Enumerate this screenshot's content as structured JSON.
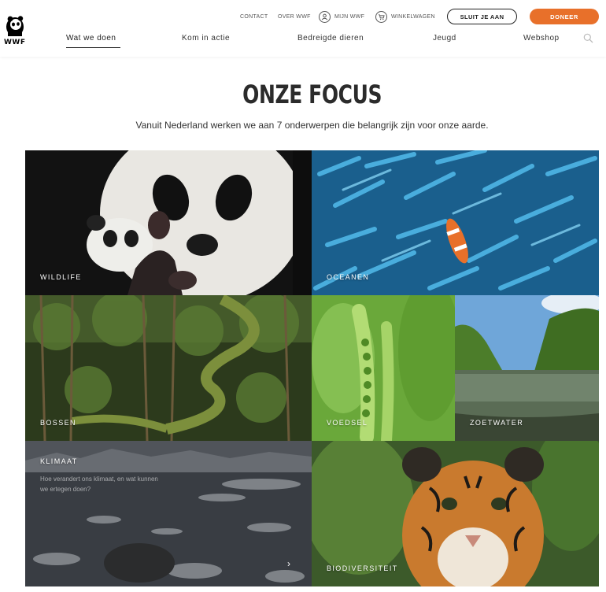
{
  "brand": {
    "logo_text": "WWF",
    "accent_color": "#e8702a"
  },
  "utility_nav": {
    "contact": "CONTACT",
    "over_wwf": "OVER WWF",
    "mijn_wwf": "MIJN WWF",
    "winkelwagen": "WINKELWAGEN",
    "sluit_je_aan": "SLUIT JE AAN",
    "doneer": "DONEER"
  },
  "main_nav": {
    "items": [
      "Wat we doen",
      "Kom in actie",
      "Bedreigde dieren",
      "Jeugd",
      "Webshop"
    ],
    "active": "Wat we doen",
    "search_icon": "search-icon"
  },
  "intro": {
    "title": "ONZE FOCUS",
    "subtitle": "Vanuit Nederland werken we aan 7 onderwerpen die belangrijk zijn voor onze aarde."
  },
  "tiles": [
    {
      "label": "WILDLIFE"
    },
    {
      "label": "OCEANEN"
    },
    {
      "label": "BOSSEN"
    },
    {
      "label": "VOEDSEL"
    },
    {
      "label": "ZOETWATER"
    },
    {
      "label": "KLIMAAT",
      "description": "Hoe verandert ons klimaat, en wat kunnen we ertegen doen?",
      "arrow": "›"
    },
    {
      "label": "BIODIVERSITEIT"
    }
  ]
}
